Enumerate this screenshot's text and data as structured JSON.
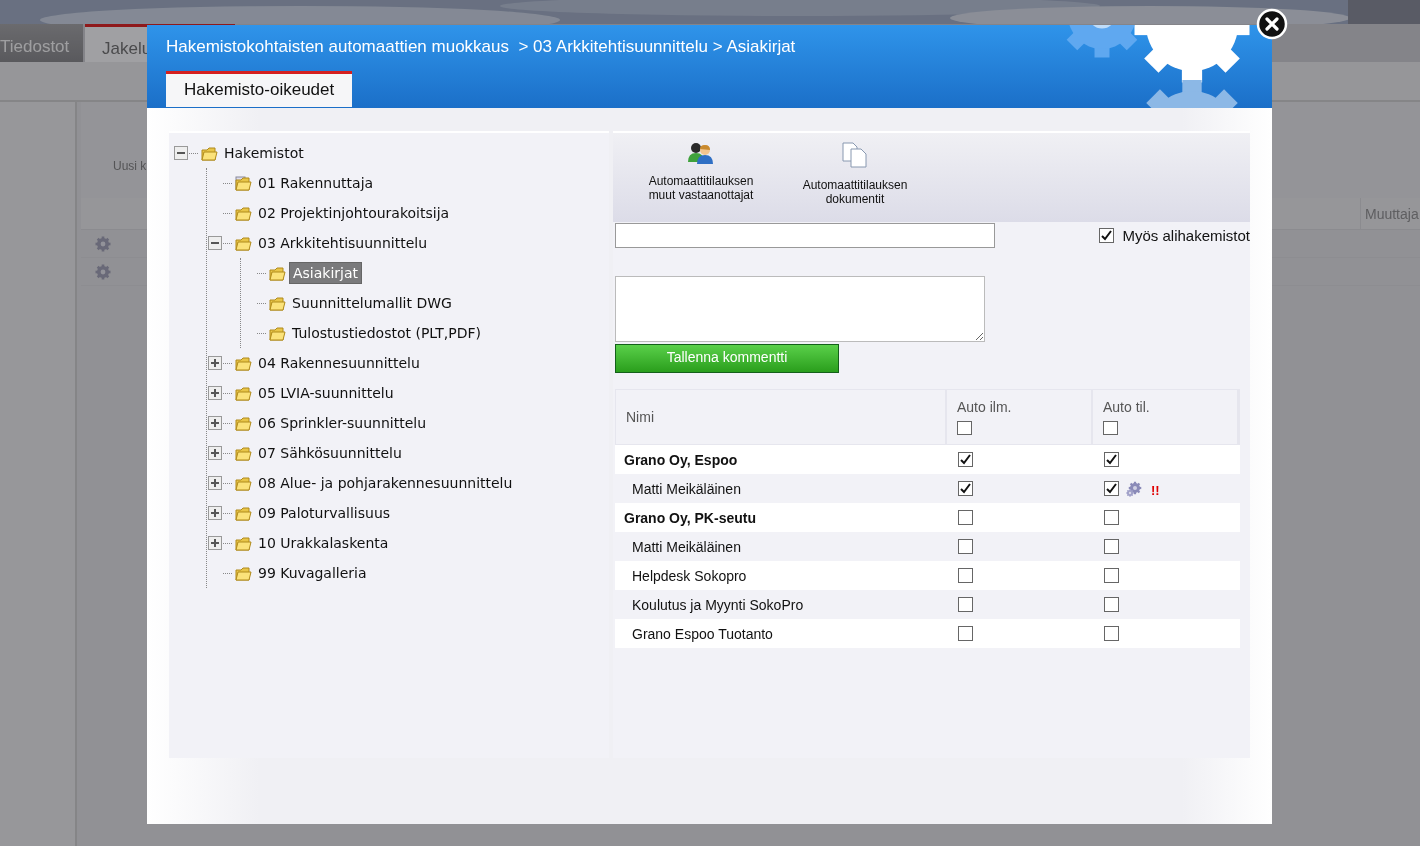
{
  "background_page": {
    "tabs": [
      {
        "label": "Tiedostot",
        "selected": false
      },
      {
        "label": "Jakelu",
        "selected": true
      }
    ],
    "toolbar_button": "Uusi k",
    "column_header": "Muuttaja"
  },
  "dialog": {
    "title": "Hakemistokohtaisten automaattien muokkaus  > 03 Arkkitehtisuunnittelu > Asiakirjat",
    "tabs": [
      {
        "label": "Hakemisto-oikeudet",
        "selected": true
      }
    ],
    "tree": [
      {
        "label": "Hakemistot",
        "kind": "folder",
        "expanded": true,
        "selected": false,
        "children": [
          {
            "label": "01 Rakennuttaja",
            "kind": "linked",
            "selected": false
          },
          {
            "label": "02 Projektinjohtourakoitsija",
            "kind": "folder",
            "selected": false
          },
          {
            "label": "03 Arkkitehtisuunnittelu",
            "kind": "folder",
            "expanded": true,
            "selected": false,
            "children": [
              {
                "label": "Asiakirjat",
                "kind": "folder",
                "selected": true
              },
              {
                "label": "Suunnittelumallit DWG",
                "kind": "folder",
                "selected": false
              },
              {
                "label": "Tulostustiedostot (PLT,PDF)",
                "kind": "folder",
                "selected": false
              }
            ]
          },
          {
            "label": "04 Rakennesuunnittelu",
            "kind": "folder",
            "expanded": false,
            "selected": false
          },
          {
            "label": "05 LVIA-suunnittelu",
            "kind": "folder",
            "expanded": false,
            "selected": false
          },
          {
            "label": "06 Sprinkler-suunnittelu",
            "kind": "folder",
            "expanded": false,
            "selected": false
          },
          {
            "label": "07 Sähkösuunnittelu",
            "kind": "folder",
            "expanded": false,
            "selected": false
          },
          {
            "label": "08 Alue- ja pohjarakennesuunnittelu",
            "kind": "folder",
            "expanded": false,
            "selected": false
          },
          {
            "label": "09 Paloturvallisuus",
            "kind": "folder",
            "expanded": false,
            "selected": false
          },
          {
            "label": "10 Urakkalaskenta",
            "kind": "folder",
            "expanded": false,
            "selected": false
          },
          {
            "label": "99 Kuvagalleria",
            "kind": "folder",
            "selected": false
          }
        ]
      }
    ],
    "toolbar": [
      {
        "label": "Automaattitilauksen muut vastaanottajat",
        "kind": "people"
      },
      {
        "label": "Automaattitilauksen dokumentit",
        "kind": "documents"
      }
    ],
    "subfolders_checkbox": {
      "label": "Myös alihakemistot",
      "checked": true
    },
    "save_comment_button": "Tallenna kommentti",
    "table": {
      "columns": [
        {
          "label": "Nimi"
        },
        {
          "label": "Auto ilm.",
          "checked": false
        },
        {
          "label": "Auto til.",
          "checked": false
        }
      ],
      "rows": [
        {
          "name": "Grano Oy, Espoo",
          "kind": "group",
          "auto_ilm": true,
          "auto_til": true
        },
        {
          "name": "Matti Meikäläinen",
          "kind": "person",
          "auto_ilm": true,
          "auto_til": true,
          "warning": "!!"
        },
        {
          "name": "Grano Oy, PK-seutu",
          "kind": "group",
          "auto_ilm": false,
          "auto_til": false
        },
        {
          "name": "Matti Meikäläinen",
          "kind": "person",
          "auto_ilm": false,
          "auto_til": false
        },
        {
          "name": "Helpdesk Sokopro",
          "kind": "person",
          "auto_ilm": false,
          "auto_til": false
        },
        {
          "name": "Koulutus ja Myynti SokoPro",
          "kind": "person",
          "auto_ilm": false,
          "auto_til": false
        },
        {
          "name": "Grano Espoo Tuotanto",
          "kind": "person",
          "auto_ilm": false,
          "auto_til": false
        }
      ]
    }
  }
}
